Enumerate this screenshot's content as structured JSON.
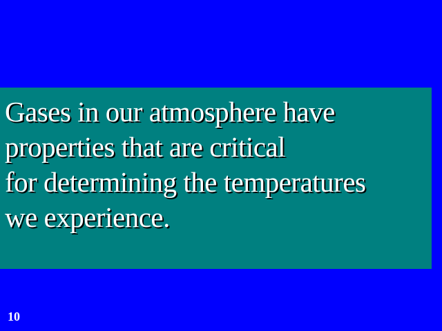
{
  "slide": {
    "background_color": "#0000ff",
    "text_box_color": "#008080",
    "text_color": "#ffffff",
    "lines": [
      "Gases in our atmosphere have",
      "properties that are critical",
      "for determining the temperatures",
      "we experience."
    ],
    "slide_number": "10",
    "slide_number_color": "#ffffff"
  }
}
